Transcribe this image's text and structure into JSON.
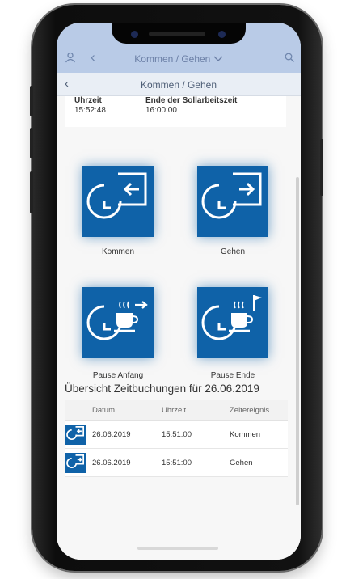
{
  "shellbar": {
    "title": "Kommen / Gehen",
    "user_icon": "user-icon",
    "back_icon": "chevron-left-icon",
    "dropdown_icon": "chevron-down-icon",
    "search_icon": "search-icon"
  },
  "navbar": {
    "title": "Kommen / Gehen",
    "back_icon": "chevron-left-icon"
  },
  "info": {
    "time_label": "Uhrzeit",
    "time_value": "15:52:48",
    "target_label": "Ende der Sollarbeitszeit",
    "target_value": "16:00:00"
  },
  "tiles": [
    {
      "label": "Kommen",
      "icon": "clock-arrow-in-icon"
    },
    {
      "label": "Gehen",
      "icon": "clock-arrow-out-icon"
    },
    {
      "label": "Pause Anfang",
      "icon": "clock-coffee-start-icon"
    },
    {
      "label": "Pause Ende",
      "icon": "clock-coffee-end-icon"
    }
  ],
  "overview": {
    "title": "Übersicht Zeitbuchungen für 26.06.2019",
    "columns": [
      "Datum",
      "Uhrzeit",
      "Zeitereignis"
    ],
    "rows": [
      {
        "date": "26.06.2019",
        "time": "15:51:00",
        "event": "Kommen",
        "icon": "clock-arrow-in-icon"
      },
      {
        "date": "26.06.2019",
        "time": "15:51:00",
        "event": "Gehen",
        "icon": "clock-arrow-out-icon"
      }
    ]
  },
  "colors": {
    "accent": "#0f62a8",
    "shellbar": "#b9cbe7",
    "navbar": "#e9eef5"
  }
}
